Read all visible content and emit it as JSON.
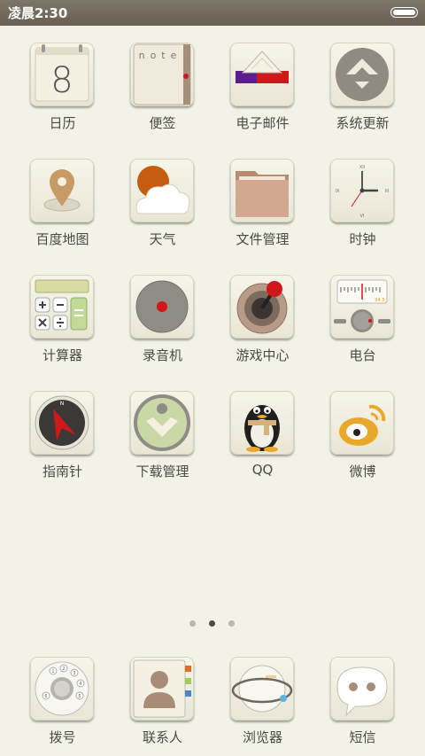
{
  "status_bar": {
    "time": "凌晨2:30",
    "battery_icon": "battery-icon"
  },
  "home": {
    "apps": [
      {
        "label": "日历",
        "icon": "calendar-icon",
        "date": "8"
      },
      {
        "label": "便签",
        "icon": "notes-icon",
        "cover_text": "note"
      },
      {
        "label": "电子邮件",
        "icon": "email-icon"
      },
      {
        "label": "系统更新",
        "icon": "system-update-icon"
      },
      {
        "label": "百度地图",
        "icon": "map-pin-icon"
      },
      {
        "label": "天气",
        "icon": "weather-icon"
      },
      {
        "label": "文件管理",
        "icon": "folder-icon"
      },
      {
        "label": "时钟",
        "icon": "clock-icon",
        "numerals": {
          "xii": "XII",
          "iii": "III",
          "vi": "VI",
          "ix": "IX"
        }
      },
      {
        "label": "计算器",
        "icon": "calculator-icon"
      },
      {
        "label": "录音机",
        "icon": "recorder-icon"
      },
      {
        "label": "游戏中心",
        "icon": "joystick-icon"
      },
      {
        "label": "电台",
        "icon": "radio-icon",
        "frequency": "94.5"
      },
      {
        "label": "指南针",
        "icon": "compass-icon",
        "north": "N"
      },
      {
        "label": "下载管理",
        "icon": "download-icon"
      },
      {
        "label": "QQ",
        "icon": "qq-penguin-icon"
      },
      {
        "label": "微博",
        "icon": "weibo-icon"
      }
    ]
  },
  "page_indicator": {
    "pages": 3,
    "current": 2
  },
  "dock": {
    "apps": [
      {
        "label": "拨号",
        "icon": "phone-dialer-icon",
        "digits": [
          "1",
          "2",
          "3",
          "4",
          "5",
          "6"
        ]
      },
      {
        "label": "联系人",
        "icon": "contacts-icon"
      },
      {
        "label": "浏览器",
        "icon": "browser-globe-icon",
        "globe_text": "www"
      },
      {
        "label": "短信",
        "icon": "messages-icon"
      }
    ]
  },
  "colors": {
    "background": "#f2f3e6",
    "status_bar": "#6e675a",
    "label": "#4a4a4a",
    "accent_red": "#d0181a"
  }
}
